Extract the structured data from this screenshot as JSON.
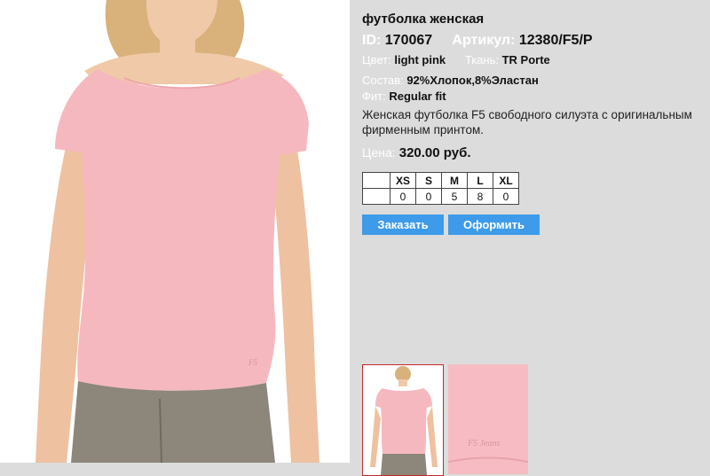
{
  "product": {
    "title": "футболка женская",
    "id_label": "ID:",
    "id_value": "170067",
    "article_label": "Артикул:",
    "article_value": "12380/F5/P",
    "color_label": "Цвет:",
    "color_value": "light pink",
    "fabric_label": "Ткань:",
    "fabric_value": "TR Porte",
    "composition_label": "Состав:",
    "composition_value": "92%Хлопок,8%Эластан",
    "fit_label": "Фит:",
    "fit_value": "Regular fit",
    "description": "Женская футболка F5 свободного силуэта с оригинальным фирменным принтом.",
    "price_label": "Цена:",
    "price_value": "320.00 руб.",
    "brand_print": "F5 Jeans"
  },
  "sizes": {
    "headers": [
      "XS",
      "S",
      "M",
      "L",
      "XL"
    ],
    "stock": [
      "0",
      "0",
      "5",
      "8",
      "0"
    ]
  },
  "actions": {
    "order_label": "Заказать",
    "checkout_label": "Оформить"
  },
  "colors": {
    "accent": "#3d9be9",
    "page_bg": "#dcdcdc",
    "shirt": "#f6b8bf",
    "active_thumb_border": "#c32a2a"
  }
}
